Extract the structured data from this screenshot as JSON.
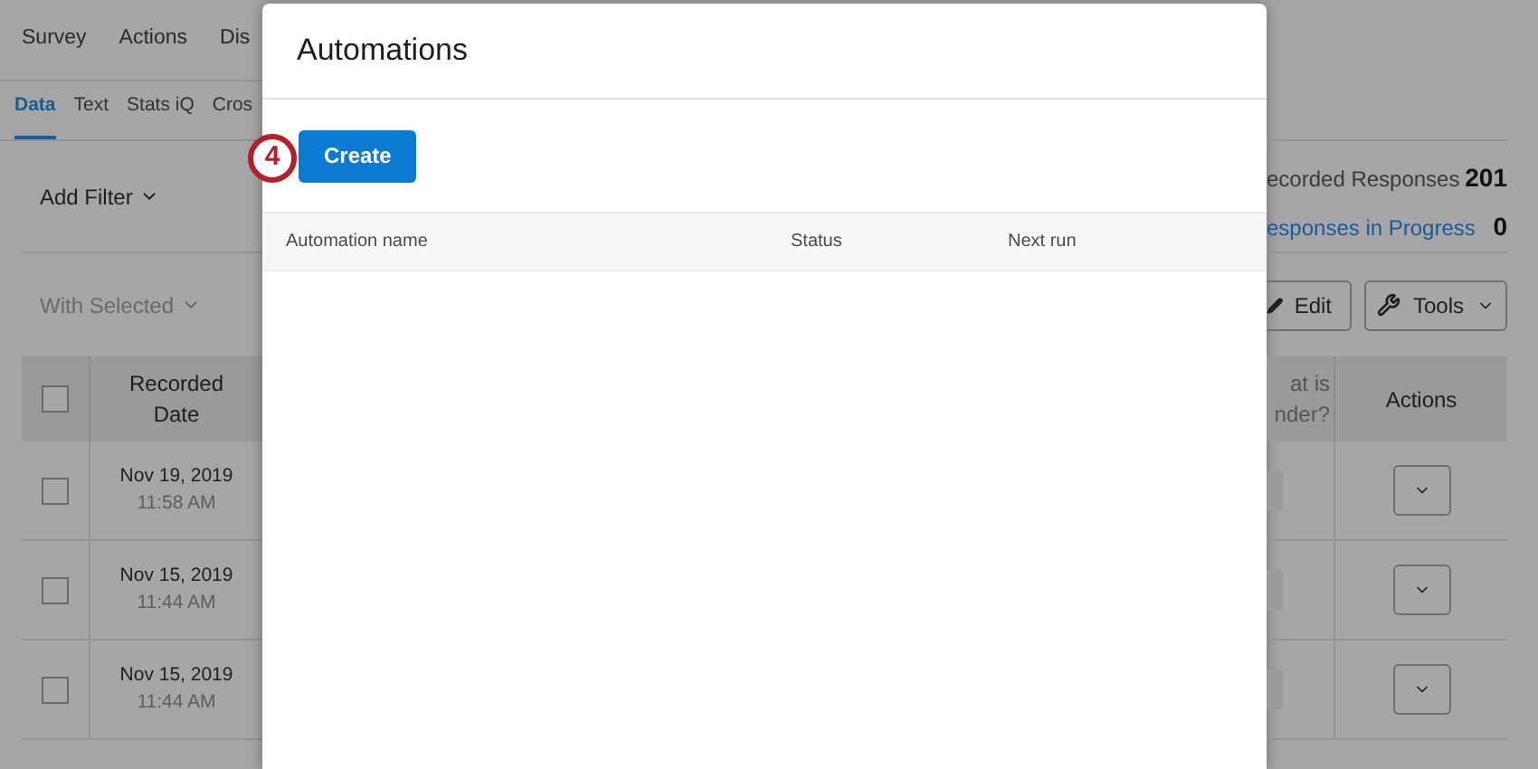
{
  "background": {
    "nav_tabs": [
      "Survey",
      "Actions",
      "Dis"
    ],
    "sub_tabs": [
      {
        "label": "Data",
        "selected": true
      },
      {
        "label": "Text",
        "selected": false
      },
      {
        "label": "Stats iQ",
        "selected": false
      },
      {
        "label": "Cros",
        "selected": false
      }
    ],
    "add_filter": "Add Filter",
    "with_selected": {
      "label": "With Selected",
      "disabled": true
    },
    "summary": [
      {
        "label": "ecorded Responses",
        "value": "201",
        "kind": "plain"
      },
      {
        "label": "esponses in Progress",
        "value": "0",
        "kind": "link"
      }
    ],
    "edit_button": "Edit",
    "tools_button": "Tools",
    "table": {
      "header_checked": false,
      "columns": [
        "Recorded Date",
        "at is nder?",
        "Actions"
      ],
      "rows": [
        {
          "checked": false,
          "date": "Nov 19, 2019",
          "time": "11:58 AM"
        },
        {
          "checked": false,
          "date": "Nov 15, 2019",
          "time": "11:44 AM"
        },
        {
          "checked": false,
          "date": "Nov 15, 2019",
          "time": "11:44 AM"
        }
      ]
    }
  },
  "modal": {
    "title": "Automations",
    "step_badge": "4",
    "create_button": "Create",
    "columns": [
      "Automation name",
      "Status",
      "Next run"
    ]
  }
}
